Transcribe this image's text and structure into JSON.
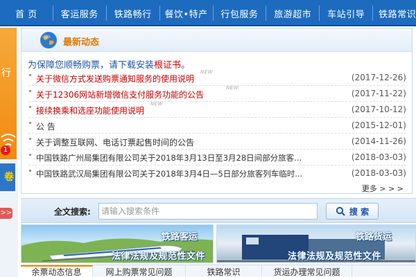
{
  "nav": {
    "items": [
      {
        "label": "首  页"
      },
      {
        "label": "客运服务"
      },
      {
        "label": "铁路畅行"
      },
      {
        "label": "餐饮•特产"
      },
      {
        "label": "行包服务"
      },
      {
        "label": "旅游超市"
      },
      {
        "label": "车站引导"
      },
      {
        "label": "铁路常识"
      }
    ]
  },
  "left": {
    "glyph": "行",
    "badge": "1",
    "blue_label": "卷",
    "arrow": ">>"
  },
  "news": {
    "title": "最新动态",
    "notice_prefix": "为保障您顺畅购票，请下载安装",
    "notice_link": "根证书",
    "notice_suffix": "。",
    "items": [
      {
        "text": "关于微信方式发送购票通知服务的使用说明",
        "date": "(2017-12-26)",
        "new": "NEW"
      },
      {
        "text": "关于12306网站新增微信支付服务功能的公告",
        "date": "(2017-11-22)",
        "new": "NEW"
      },
      {
        "text": "接续换乘和选座功能使用说明",
        "date": "(2017-10-12)",
        "new": "NEW"
      },
      {
        "text": "公  告",
        "date": "(2015-12-01)"
      },
      {
        "text": "关于调整互联网、电话订票起售时间的公告",
        "date": "(2014-11-26)"
      },
      {
        "text": "中国铁路广州局集团有限公司关于2018年3月13日至3月28日间部分旅客...",
        "date": "(2018-03-03)"
      },
      {
        "text": "中国铁路武汉局集团有限公司关于2018年3月4日—5日部分旅客列车临时...",
        "date": "(2018-03-03)"
      }
    ],
    "more": "更多 > > >"
  },
  "search": {
    "label": "全文搜索:",
    "placeholder": "请输入搜索条件",
    "button": "搜 索"
  },
  "banners": {
    "passenger_tag": "铁路客运",
    "passenger_sub": "法律法规及规范性文件",
    "freight_tag": "铁路货运",
    "freight_sub": "法律法规及规范性文件"
  },
  "tabs": [
    {
      "label": "余票动态信息"
    },
    {
      "label": "网上购票常见问题"
    },
    {
      "label": "铁路常识"
    },
    {
      "label": "货运办理常见问题"
    }
  ],
  "colors": {
    "nav_bg": "#1c6bbf",
    "title_orange": "#e07a00",
    "link_red": "#d40000",
    "news_red": "#c80000"
  }
}
